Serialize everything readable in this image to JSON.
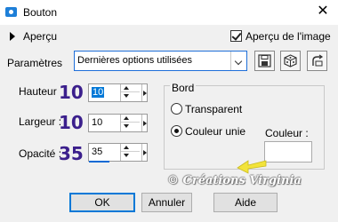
{
  "window": {
    "title": "Bouton",
    "close_glyph": "✕"
  },
  "preview": {
    "label": "Aperçu",
    "image_preview_label": "Aperçu de l'image",
    "image_preview_checked": true
  },
  "params": {
    "label": "Paramètres",
    "value": "Dernières options utilisées"
  },
  "fields": {
    "hauteur": {
      "label": "Hauteur",
      "tag": "10",
      "value": "10"
    },
    "largeur": {
      "label": "Largeur :",
      "tag": "10",
      "value": "10"
    },
    "opacite": {
      "label": "Opacité :",
      "tag": "35",
      "value": "35",
      "level_percent": 35
    }
  },
  "bord": {
    "title": "Bord",
    "transparent_label": "Transparent",
    "couleur_unie_label": "Couleur unie",
    "selected": "couleur_unie",
    "color_label": "Couleur :",
    "color_value": "#ffffff"
  },
  "watermark": "© Créations Virginia",
  "buttons": {
    "ok": "OK",
    "annuler": "Annuler",
    "aide": "Aide"
  },
  "colors": {
    "accent": "#0078d7",
    "tag": "#3b1f8c",
    "arrow": "#f2e33a"
  }
}
